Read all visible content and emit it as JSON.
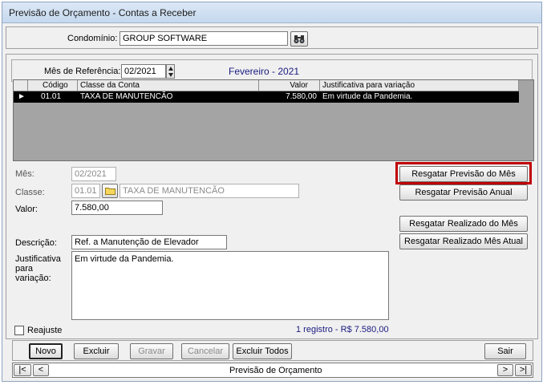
{
  "window": {
    "title": "Previsão de Orçamento - Contas a Receber"
  },
  "condominio": {
    "label": "Condomínio:",
    "value": "GROUP SOFTWARE",
    "search_icon": "binoculars-icon"
  },
  "referencia": {
    "label": "Mês de Referência:",
    "value": "02/2021",
    "month_name": "Fevereiro - 2021"
  },
  "grid": {
    "columns": [
      "Código",
      "Classe da Conta",
      "Valor",
      "Justificativa para variação"
    ],
    "rows": [
      {
        "codigo": "01.01",
        "classe": "TAXA DE MANUTENCÃO",
        "valor": "7.580,00",
        "justificativa": "Em virtude da Pandemia."
      }
    ]
  },
  "detail": {
    "mes_label": "Mês:",
    "mes_value": "02/2021",
    "classe_label": "Classe:",
    "classe_code": "01.01",
    "classe_name": "TAXA DE MANUTENCÃO",
    "valor_label": "Valor:",
    "valor_value": "7.580,00",
    "descricao_label": "Descrição:",
    "descricao_value": "Ref. a Manutenção de Elevador",
    "justificativa_label_1": "Justificativa",
    "justificativa_label_2": "para",
    "justificativa_label_3": "variação:",
    "justificativa_value": "Em virtude da Pandemia."
  },
  "actions": {
    "resgatar_previsao_mes": "Resgatar Previsão do Mês",
    "resgatar_previsao_anual": "Resgatar Previsão Anual",
    "resgatar_realizado_mes": "Resgatar Realizado do Mês",
    "resgatar_realizado_mes_atual": "Resgatar Realizado Mês Atual",
    "highlight_color": "#c00000"
  },
  "status": {
    "reajuste_label": "Reajuste",
    "summary": "1 registro - R$ 7.580,00"
  },
  "toolbar": {
    "novo": "Novo",
    "excluir": "Excluir",
    "gravar": "Gravar",
    "cancelar": "Cancelar",
    "excluir_todos": "Excluir Todos",
    "sair": "Sair"
  },
  "navigator": {
    "first": "|<",
    "prev": "<",
    "caption": "Previsão de Orçamento",
    "next": ">",
    "last": ">|"
  }
}
